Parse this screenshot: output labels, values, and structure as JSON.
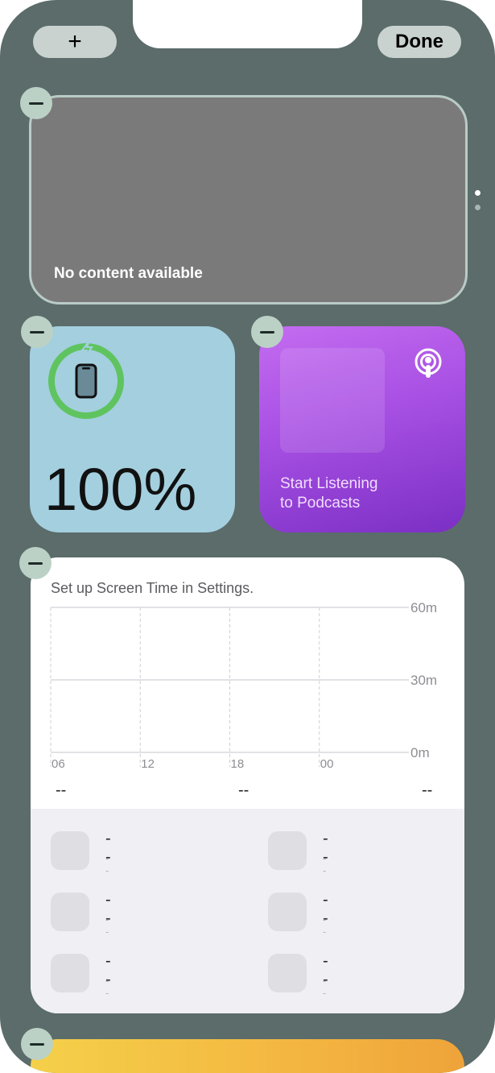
{
  "toolbar": {
    "add_label": "+",
    "done_label": "Done"
  },
  "page_indicator": {
    "pages": 2,
    "current": 1
  },
  "empty_widget": {
    "message": "No content available"
  },
  "battery_widget": {
    "percentage": "100%",
    "level": 1.0,
    "charging": true,
    "ring_color": "#5fc45f"
  },
  "podcasts_widget": {
    "text": "Start Listening\nto Podcasts",
    "icon": "podcasts-icon"
  },
  "screen_time_widget": {
    "title": "Set up Screen Time in Settings.",
    "chart_data": {
      "type": "bar",
      "x": [
        "06",
        "12",
        "18",
        "00"
      ],
      "y_ticks": [
        "60m",
        "30m",
        "0m"
      ],
      "series": [],
      "grid": true
    },
    "summary": [
      "--",
      "--",
      "--"
    ],
    "apps": [
      {
        "name": "--",
        "time": "--"
      },
      {
        "name": "--",
        "time": "--"
      },
      {
        "name": "--",
        "time": "--"
      },
      {
        "name": "--",
        "time": "--"
      },
      {
        "name": "--",
        "time": "--"
      },
      {
        "name": "--",
        "time": "--"
      }
    ]
  },
  "colors": {
    "background": "#5b6c6a",
    "battery": "#a4cfdf",
    "podcasts_accent": "#a74fe3",
    "notes": "#f3b23f"
  }
}
